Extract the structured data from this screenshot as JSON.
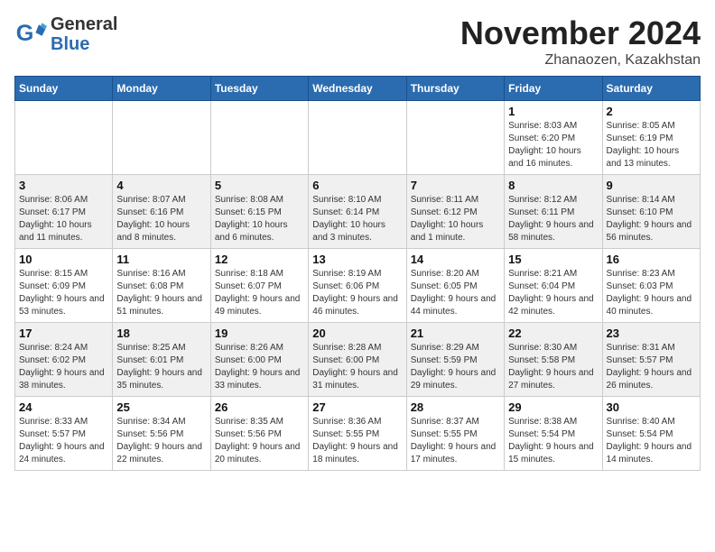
{
  "header": {
    "logo_general": "General",
    "logo_blue": "Blue",
    "month_title": "November 2024",
    "location": "Zhanaozen, Kazakhstan"
  },
  "weekdays": [
    "Sunday",
    "Monday",
    "Tuesday",
    "Wednesday",
    "Thursday",
    "Friday",
    "Saturday"
  ],
  "weeks": [
    [
      {
        "day": "",
        "info": ""
      },
      {
        "day": "",
        "info": ""
      },
      {
        "day": "",
        "info": ""
      },
      {
        "day": "",
        "info": ""
      },
      {
        "day": "",
        "info": ""
      },
      {
        "day": "1",
        "info": "Sunrise: 8:03 AM\nSunset: 6:20 PM\nDaylight: 10 hours and 16 minutes."
      },
      {
        "day": "2",
        "info": "Sunrise: 8:05 AM\nSunset: 6:19 PM\nDaylight: 10 hours and 13 minutes."
      }
    ],
    [
      {
        "day": "3",
        "info": "Sunrise: 8:06 AM\nSunset: 6:17 PM\nDaylight: 10 hours and 11 minutes."
      },
      {
        "day": "4",
        "info": "Sunrise: 8:07 AM\nSunset: 6:16 PM\nDaylight: 10 hours and 8 minutes."
      },
      {
        "day": "5",
        "info": "Sunrise: 8:08 AM\nSunset: 6:15 PM\nDaylight: 10 hours and 6 minutes."
      },
      {
        "day": "6",
        "info": "Sunrise: 8:10 AM\nSunset: 6:14 PM\nDaylight: 10 hours and 3 minutes."
      },
      {
        "day": "7",
        "info": "Sunrise: 8:11 AM\nSunset: 6:12 PM\nDaylight: 10 hours and 1 minute."
      },
      {
        "day": "8",
        "info": "Sunrise: 8:12 AM\nSunset: 6:11 PM\nDaylight: 9 hours and 58 minutes."
      },
      {
        "day": "9",
        "info": "Sunrise: 8:14 AM\nSunset: 6:10 PM\nDaylight: 9 hours and 56 minutes."
      }
    ],
    [
      {
        "day": "10",
        "info": "Sunrise: 8:15 AM\nSunset: 6:09 PM\nDaylight: 9 hours and 53 minutes."
      },
      {
        "day": "11",
        "info": "Sunrise: 8:16 AM\nSunset: 6:08 PM\nDaylight: 9 hours and 51 minutes."
      },
      {
        "day": "12",
        "info": "Sunrise: 8:18 AM\nSunset: 6:07 PM\nDaylight: 9 hours and 49 minutes."
      },
      {
        "day": "13",
        "info": "Sunrise: 8:19 AM\nSunset: 6:06 PM\nDaylight: 9 hours and 46 minutes."
      },
      {
        "day": "14",
        "info": "Sunrise: 8:20 AM\nSunset: 6:05 PM\nDaylight: 9 hours and 44 minutes."
      },
      {
        "day": "15",
        "info": "Sunrise: 8:21 AM\nSunset: 6:04 PM\nDaylight: 9 hours and 42 minutes."
      },
      {
        "day": "16",
        "info": "Sunrise: 8:23 AM\nSunset: 6:03 PM\nDaylight: 9 hours and 40 minutes."
      }
    ],
    [
      {
        "day": "17",
        "info": "Sunrise: 8:24 AM\nSunset: 6:02 PM\nDaylight: 9 hours and 38 minutes."
      },
      {
        "day": "18",
        "info": "Sunrise: 8:25 AM\nSunset: 6:01 PM\nDaylight: 9 hours and 35 minutes."
      },
      {
        "day": "19",
        "info": "Sunrise: 8:26 AM\nSunset: 6:00 PM\nDaylight: 9 hours and 33 minutes."
      },
      {
        "day": "20",
        "info": "Sunrise: 8:28 AM\nSunset: 6:00 PM\nDaylight: 9 hours and 31 minutes."
      },
      {
        "day": "21",
        "info": "Sunrise: 8:29 AM\nSunset: 5:59 PM\nDaylight: 9 hours and 29 minutes."
      },
      {
        "day": "22",
        "info": "Sunrise: 8:30 AM\nSunset: 5:58 PM\nDaylight: 9 hours and 27 minutes."
      },
      {
        "day": "23",
        "info": "Sunrise: 8:31 AM\nSunset: 5:57 PM\nDaylight: 9 hours and 26 minutes."
      }
    ],
    [
      {
        "day": "24",
        "info": "Sunrise: 8:33 AM\nSunset: 5:57 PM\nDaylight: 9 hours and 24 minutes."
      },
      {
        "day": "25",
        "info": "Sunrise: 8:34 AM\nSunset: 5:56 PM\nDaylight: 9 hours and 22 minutes."
      },
      {
        "day": "26",
        "info": "Sunrise: 8:35 AM\nSunset: 5:56 PM\nDaylight: 9 hours and 20 minutes."
      },
      {
        "day": "27",
        "info": "Sunrise: 8:36 AM\nSunset: 5:55 PM\nDaylight: 9 hours and 18 minutes."
      },
      {
        "day": "28",
        "info": "Sunrise: 8:37 AM\nSunset: 5:55 PM\nDaylight: 9 hours and 17 minutes."
      },
      {
        "day": "29",
        "info": "Sunrise: 8:38 AM\nSunset: 5:54 PM\nDaylight: 9 hours and 15 minutes."
      },
      {
        "day": "30",
        "info": "Sunrise: 8:40 AM\nSunset: 5:54 PM\nDaylight: 9 hours and 14 minutes."
      }
    ]
  ]
}
